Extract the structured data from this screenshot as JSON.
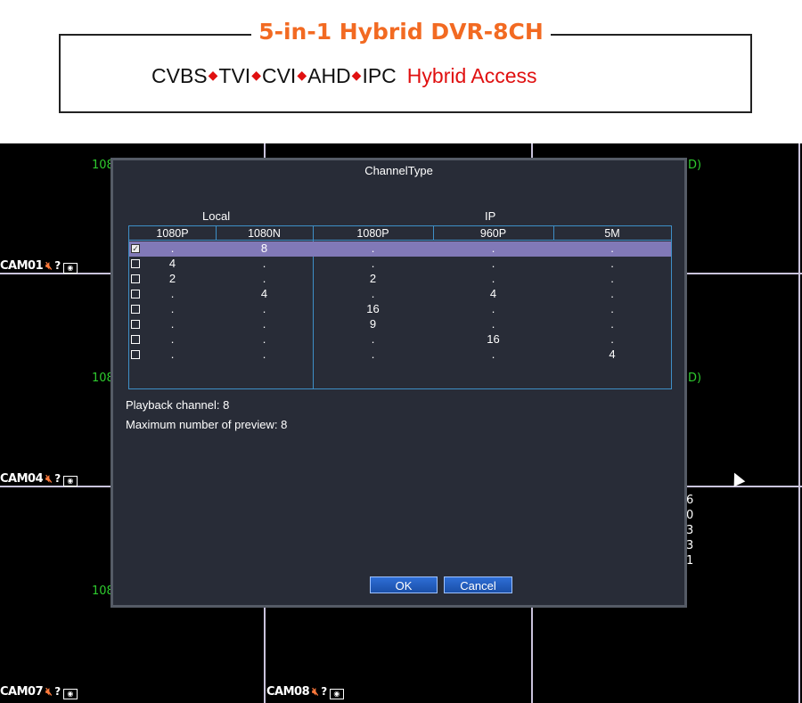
{
  "banner": {
    "title": "5-in-1 Hybrid DVR-8CH",
    "formats": [
      "CVBS",
      "TVI",
      "CVI",
      "AHD",
      "IPC"
    ],
    "diamond": "◆",
    "hybrid": "Hybrid Access"
  },
  "cameras": {
    "cam01": "CAM01",
    "cam04": "CAM04",
    "cam07": "CAM07",
    "cam08": "CAM08"
  },
  "osd": {
    "g1": "108",
    "g2": "108",
    "g3": "108",
    "r1": "D)",
    "r2": "D)",
    "side": [
      "6",
      "0",
      "3",
      "3",
      "1"
    ]
  },
  "dialog": {
    "title": "ChannelType",
    "group_local": "Local",
    "group_ip": "IP",
    "columns": [
      "1080P",
      "1080N",
      "1080P",
      "960P",
      "5M"
    ],
    "rows": [
      {
        "checked": true,
        "cells": [
          ".",
          "8",
          ".",
          ".",
          "."
        ]
      },
      {
        "checked": false,
        "cells": [
          "4",
          ".",
          ".",
          ".",
          "."
        ]
      },
      {
        "checked": false,
        "cells": [
          "2",
          ".",
          "2",
          ".",
          "."
        ]
      },
      {
        "checked": false,
        "cells": [
          ".",
          "4",
          ".",
          "4",
          "."
        ]
      },
      {
        "checked": false,
        "cells": [
          ".",
          ".",
          "16",
          ".",
          "."
        ]
      },
      {
        "checked": false,
        "cells": [
          ".",
          ".",
          "9",
          ".",
          "."
        ]
      },
      {
        "checked": false,
        "cells": [
          ".",
          ".",
          ".",
          "16",
          "."
        ]
      },
      {
        "checked": false,
        "cells": [
          ".",
          ".",
          ".",
          ".",
          "4"
        ]
      }
    ],
    "playback": "Playback channel: 8",
    "max_preview": "Maximum number of preview: 8",
    "ok_label": "OK",
    "cancel_label": "Cancel"
  },
  "colors": {
    "accent_orange": "#f26a22",
    "accent_red": "#e01010",
    "selected_row": "#8179b7",
    "table_border": "#3e8fc7",
    "osd_green": "#2ecb2e"
  }
}
